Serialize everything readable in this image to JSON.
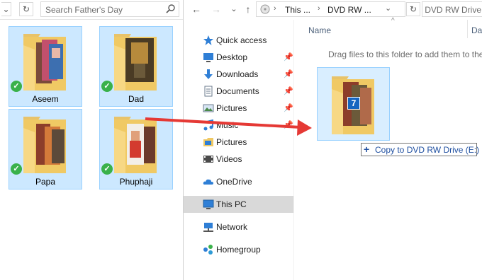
{
  "left_window": {
    "search": {
      "placeholder": "Search Father's Day"
    },
    "folders": [
      {
        "name": "Aseem"
      },
      {
        "name": "Dad"
      },
      {
        "name": "Papa"
      },
      {
        "name": "Phuphaji"
      }
    ]
  },
  "right_window": {
    "breadcrumbs": [
      "This ...",
      "DVD RW ..."
    ],
    "search": {
      "placeholder": "Search DVD RW Drive"
    },
    "column_headers": {
      "name": "Name",
      "date": "Dat"
    },
    "nav_pane": {
      "quick_access": "Quick access",
      "quick_items": [
        {
          "label": "Desktop",
          "icon": "desktop-icon",
          "pinned": true
        },
        {
          "label": "Downloads",
          "icon": "downloads-icon",
          "pinned": true
        },
        {
          "label": "Documents",
          "icon": "documents-icon",
          "pinned": true
        },
        {
          "label": "Pictures",
          "icon": "pictures-icon",
          "pinned": true
        },
        {
          "label": "Music",
          "icon": "music-icon",
          "pinned": true
        },
        {
          "label": "Pictures",
          "icon": "pictures-library-icon",
          "pinned": false
        },
        {
          "label": "Videos",
          "icon": "videos-icon",
          "pinned": false
        }
      ],
      "onedrive": "OneDrive",
      "this_pc": "This PC",
      "network": "Network",
      "homegroup": "Homegroup"
    },
    "empty_hint": "Drag files to this folder to add them to the"
  },
  "drag": {
    "count_badge": "7",
    "tooltip": "Copy to DVD RW Drive (E:)",
    "tooltip_symbol": "+"
  },
  "colors": {
    "selection_fill": "#cce8ff",
    "selection_border": "#99d1ff",
    "check_green": "#3ab14a",
    "arrow_red": "#e53935",
    "badge_blue": "#1565c0"
  }
}
